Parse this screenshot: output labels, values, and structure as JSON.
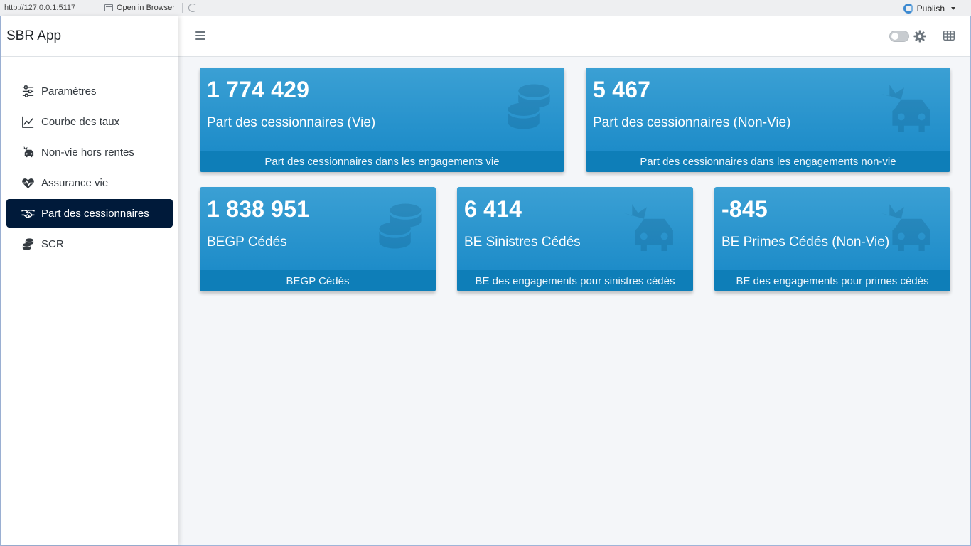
{
  "viewer": {
    "url": "http://127.0.0.1:5117",
    "open_in_browser": "Open in Browser",
    "publish": "Publish"
  },
  "app": {
    "title": "SBR App"
  },
  "sidebar": {
    "items": [
      {
        "label": "Paramètres",
        "icon": "sliders-icon"
      },
      {
        "label": "Courbe des taux",
        "icon": "line-chart-icon"
      },
      {
        "label": "Non-vie hors rentes",
        "icon": "car-crash-icon"
      },
      {
        "label": "Assurance vie",
        "icon": "heartbeat-icon"
      },
      {
        "label": "Part des cessionnaires",
        "icon": "handshake-icon",
        "active": true
      },
      {
        "label": "SCR",
        "icon": "coins-icon"
      }
    ]
  },
  "colors": {
    "box_bg": "#1c8dca",
    "box_footer": "#0e7eb8",
    "active_nav": "#001a3a"
  },
  "boxes": [
    {
      "value": "1 774 429",
      "label": "Part des cessionnaires (Vie)",
      "footer": "Part des cessionnaires dans les engagements vie",
      "icon": "coins-icon"
    },
    {
      "value": "5 467",
      "label": "Part des cessionnaires (Non-Vie)",
      "footer": "Part des cessionnaires dans les engagements non-vie",
      "icon": "car-crash-icon"
    },
    {
      "value": "1 838 951",
      "label": "BEGP Cédés",
      "footer": "BEGP Cédés",
      "icon": "coins-icon"
    },
    {
      "value": "6 414",
      "label": "BE Sinistres Cédés",
      "footer": "BE des engagements pour sinistres cédés",
      "icon": "car-crash-icon"
    },
    {
      "value": "-845",
      "label": "BE Primes Cédés (Non-Vie)",
      "footer": "BE des engagements pour primes cédés",
      "icon": "car-crash-icon"
    }
  ]
}
